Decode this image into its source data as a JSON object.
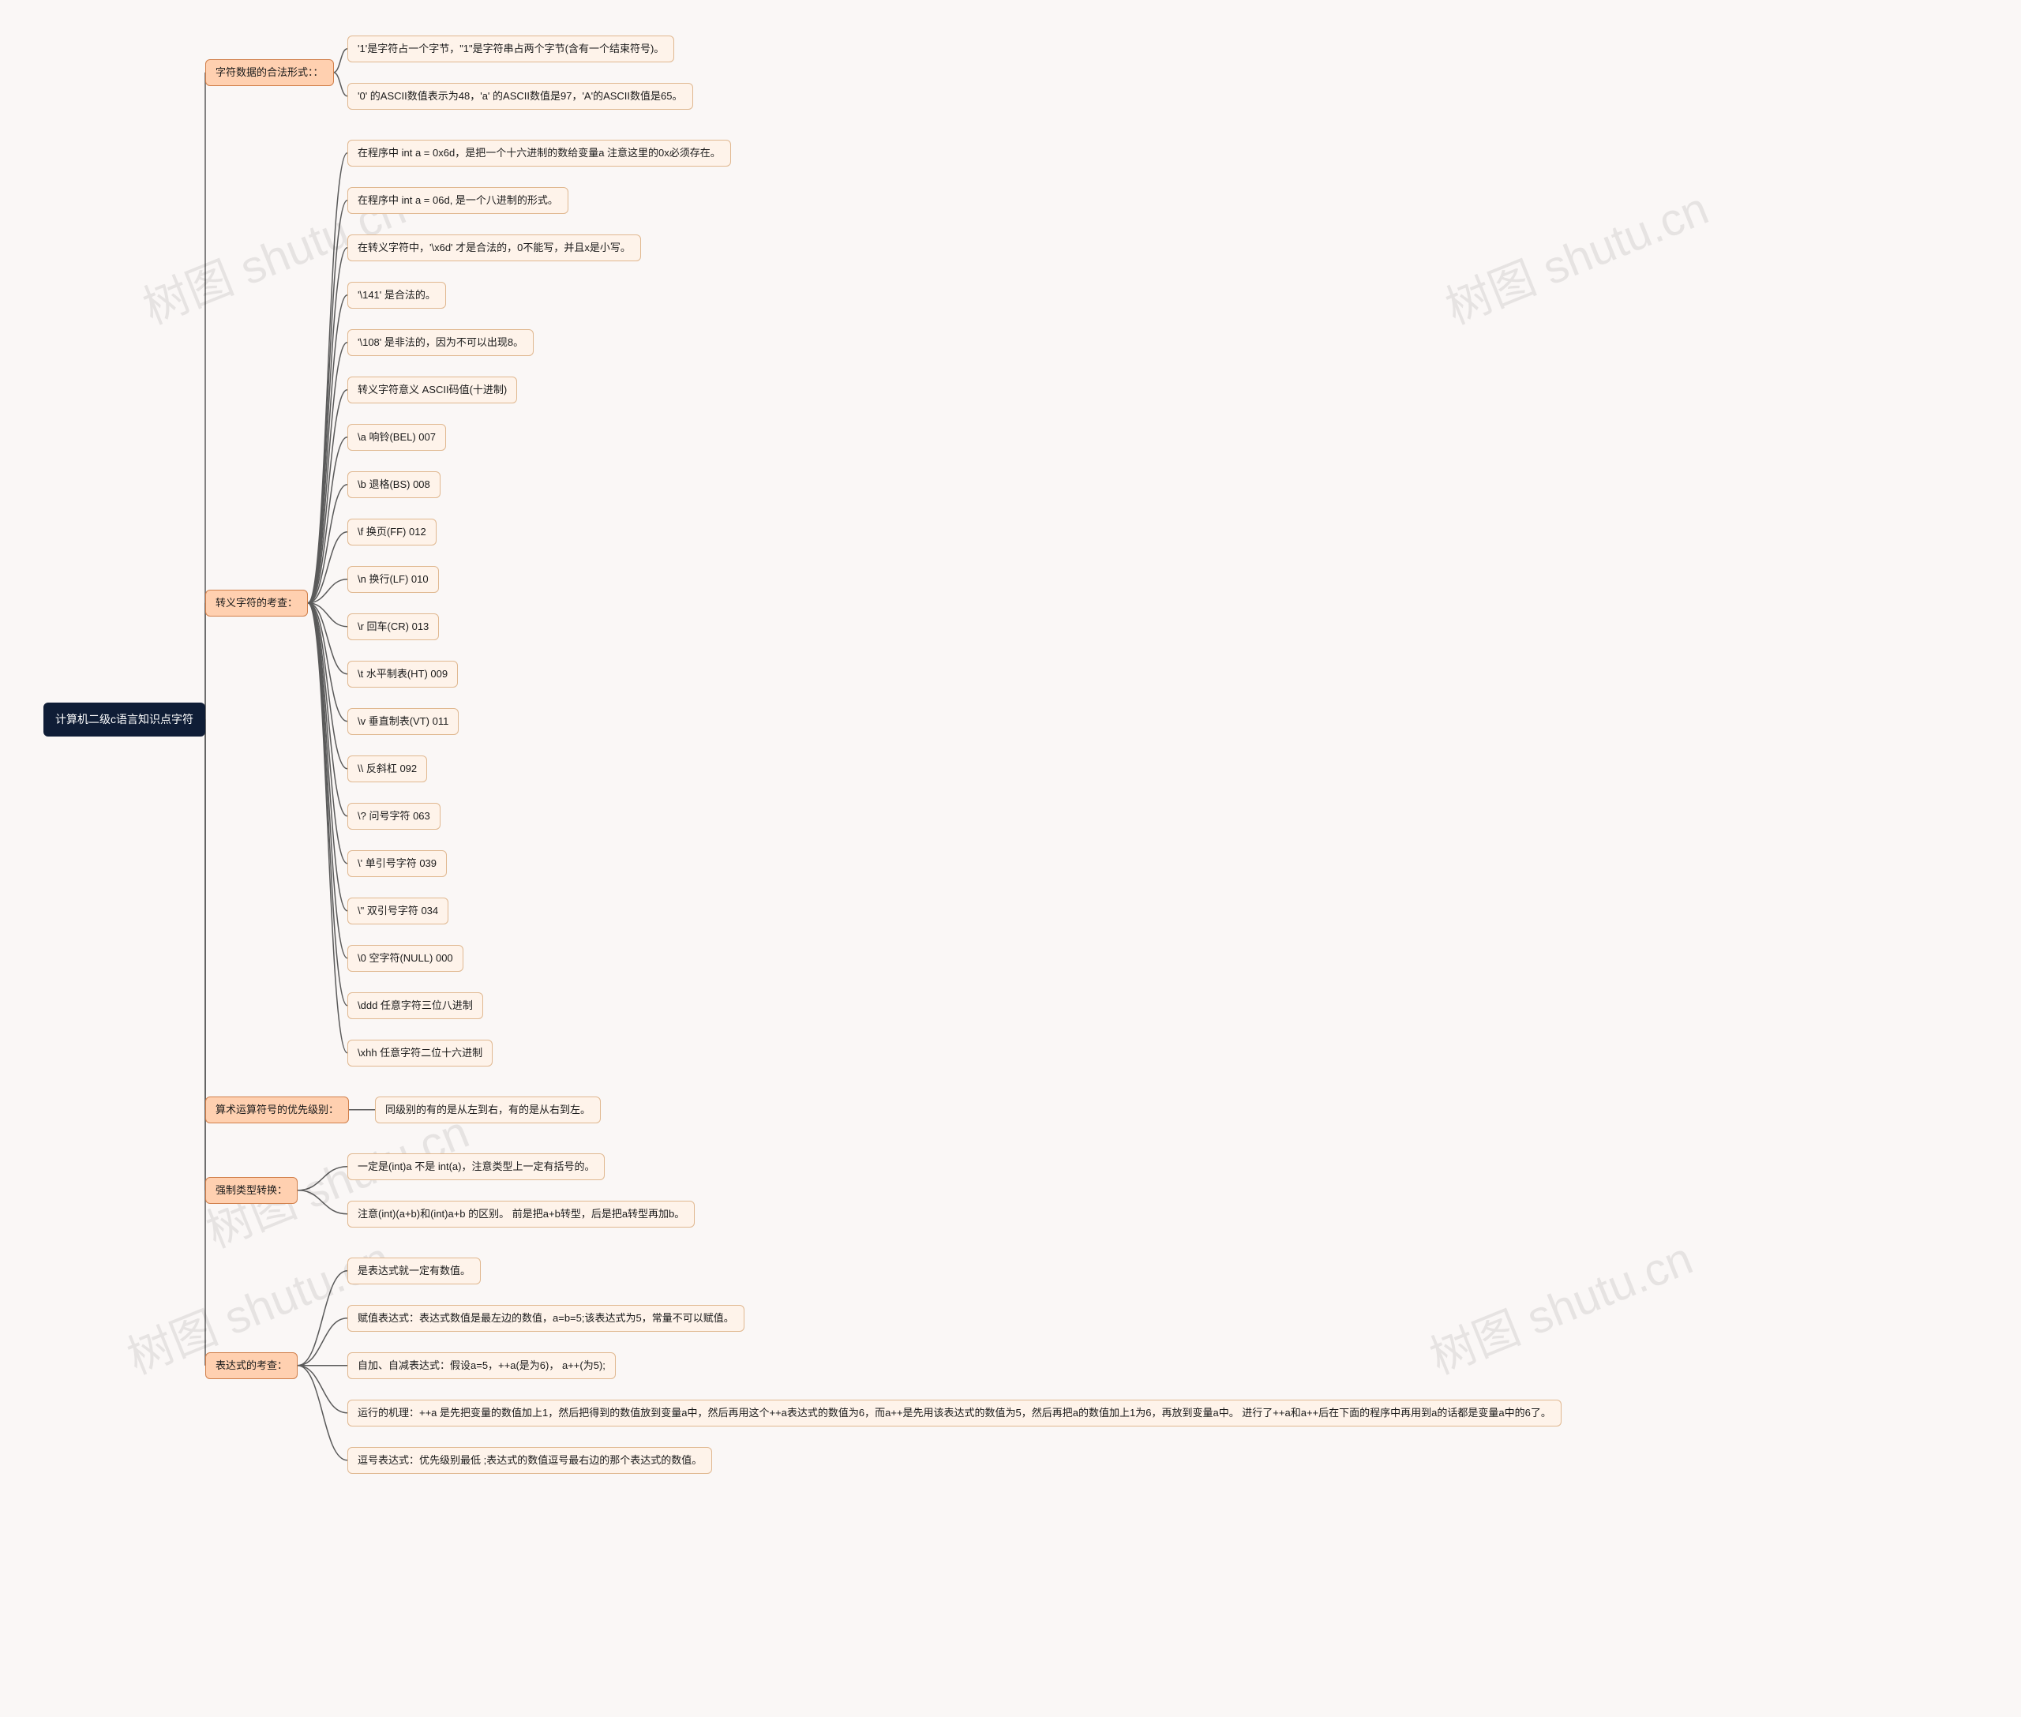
{
  "watermark_text": "树图 shutu.cn",
  "root": {
    "label": "计算机二级c语言知识点字符"
  },
  "branches": [
    {
      "label": "字符数据的合法形式：：",
      "children": [
        "'1'是字符占一个字节，\"1\"是字符串占两个字节(含有一个结束符号)。",
        "'0' 的ASCII数值表示为48，'a' 的ASCII数值是97，'A'的ASCII数值是65。"
      ]
    },
    {
      "label": "转义字符的考查：",
      "children": [
        "在程序中 int a = 0x6d，是把一个十六进制的数给变量a 注意这里的0x必须存在。",
        "在程序中 int a = 06d, 是一个八进制的形式。",
        "在转义字符中，'\\x6d' 才是合法的，0不能写，并且x是小写。",
        "'\\141' 是合法的。",
        "'\\108' 是非法的，因为不可以出现8。",
        "转义字符意义 ASCII码值(十进制)",
        "\\a 响铃(BEL) 007",
        "\\b 退格(BS) 008",
        "\\f 换页(FF) 012",
        "\\n 换行(LF) 010",
        "\\r 回车(CR) 013",
        "\\t 水平制表(HT) 009",
        "\\v 垂直制表(VT) 011",
        "\\\\ 反斜杠 092",
        "\\? 问号字符 063",
        "\\' 单引号字符 039",
        "\\\" 双引号字符 034",
        "\\0 空字符(NULL) 000",
        "\\ddd 任意字符三位八进制",
        "\\xhh 任意字符二位十六进制"
      ]
    },
    {
      "label": "算术运算符号的优先级别：",
      "children": [
        "同级别的有的是从左到右，有的是从右到左。"
      ]
    },
    {
      "label": "强制类型转换：",
      "children": [
        "一定是(int)a 不是 int(a)，注意类型上一定有括号的。",
        "注意(int)(a+b)和(int)a+b 的区别。 前是把a+b转型，后是把a转型再加b。"
      ]
    },
    {
      "label": "表达式的考查：",
      "children": [
        "是表达式就一定有数值。",
        "赋值表达式：表达式数值是最左边的数值，a=b=5;该表达式为5，常量不可以赋值。",
        "自加、自减表达式：假设a=5，++a(是为6)， a++(为5);",
        "运行的机理：++a 是先把变量的数值加上1，然后把得到的数值放到变量a中，然后再用这个++a表达式的数值为6，而a++是先用该表达式的数值为5，然后再把a的数值加上1为6，再放到变量a中。 进行了++a和a++后在下面的程序中再用到a的话都是变量a中的6了。",
        "逗号表达式：优先级别最低 ;表达式的数值逗号最右边的那个表达式的数值。"
      ]
    }
  ]
}
